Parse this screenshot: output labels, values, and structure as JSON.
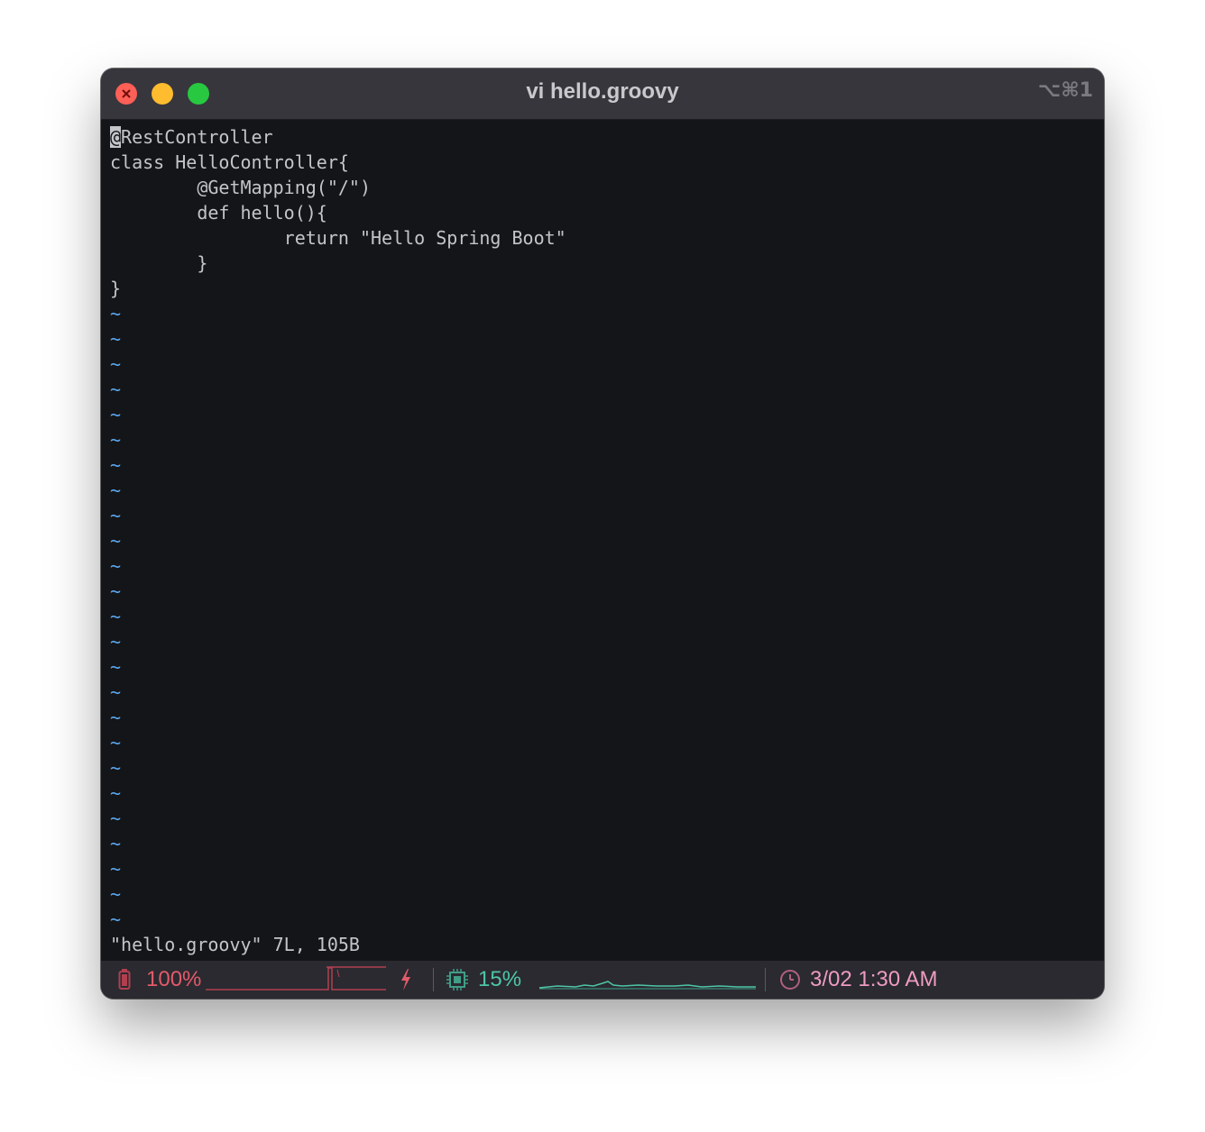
{
  "window": {
    "title": "vi hello.groovy",
    "shortcut": "⌥⌘1"
  },
  "editor": {
    "lines": [
      {
        "cursor_char": "@",
        "rest": "RestController"
      },
      {
        "text": "class HelloController{"
      },
      {
        "text": "        @GetMapping(\"/\")"
      },
      {
        "text": "        def hello(){"
      },
      {
        "text": "                return \"Hello Spring Boot\""
      },
      {
        "text": "        }"
      },
      {
        "text": "}"
      }
    ],
    "empty_line_marker": "~",
    "message": "\"hello.groovy\" 7L, 105B"
  },
  "status_bar": {
    "battery": {
      "icon": "battery-icon",
      "percent": "100%",
      "charging_icon": "lightning-bolt-icon",
      "color": "#e35a6a"
    },
    "cpu": {
      "icon": "cpu-chip-icon",
      "percent": "15%",
      "color": "#4fc5a6"
    },
    "clock": {
      "icon": "clock-icon",
      "time": "3/02 1:30 AM",
      "color": "#ee9bc2"
    }
  },
  "colors": {
    "background": "#141519",
    "titlebar": "#37363d",
    "text": "#c3c5c9",
    "tilde": "#5ba7ee"
  }
}
